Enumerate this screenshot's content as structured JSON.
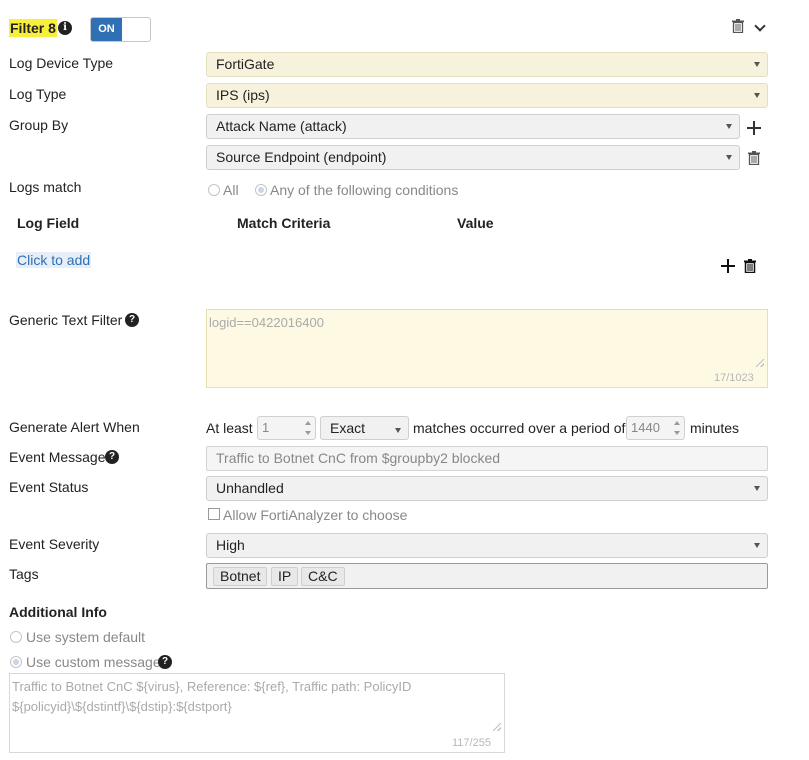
{
  "header": {
    "title": "Filter 8",
    "toggle_label": "ON",
    "delete_icon": "trash-icon",
    "collapse_icon": "chevron-down-icon"
  },
  "fields": {
    "log_device_type": {
      "label": "Log Device Type",
      "value": "FortiGate"
    },
    "log_type": {
      "label": "Log Type",
      "value": "IPS (ips)"
    },
    "group_by": {
      "label": "Group By",
      "values": [
        "Attack Name (attack)",
        "Source Endpoint (endpoint)"
      ]
    },
    "logs_match": {
      "label": "Logs match",
      "options": [
        "All",
        "Any of the following conditions"
      ],
      "selected": "Any of the following conditions"
    },
    "conditions_table": {
      "headers": [
        "Log Field",
        "Match Criteria",
        "Value"
      ],
      "add_link": "Click to add"
    },
    "generic_text_filter": {
      "label": "Generic Text Filter",
      "placeholder": "logid==0422016400",
      "counter": "17/1023"
    },
    "generate_alert": {
      "label": "Generate Alert When",
      "prefix": "At least",
      "count": "1",
      "mode": "Exact",
      "middle": "matches occurred over a period of",
      "period": "1440",
      "suffix": "minutes"
    },
    "event_message": {
      "label": "Event Message",
      "value": "Traffic to Botnet CnC from $groupby2 blocked"
    },
    "event_status": {
      "label": "Event Status",
      "value": "Unhandled",
      "checkbox_label": "Allow FortiAnalyzer to choose"
    },
    "event_severity": {
      "label": "Event Severity",
      "value": "High"
    },
    "tags": {
      "label": "Tags",
      "items": [
        "Botnet",
        "IP",
        "C&C"
      ]
    },
    "additional_info": {
      "label": "Additional Info",
      "options": [
        "Use system default",
        "Use custom message"
      ],
      "selected": "Use custom message",
      "message_line1": "Traffic to Botnet CnC ${virus},  Reference: ${ref}, Traffic path: PolicyID",
      "message_line2": "${policyid}\\${dstintf}\\${dstip}:${dstport}",
      "counter": "117/255"
    }
  },
  "colors": {
    "accent": "#2f6fb3",
    "highlight": "#f7ef3b",
    "selected_field": "#f6f2dc"
  }
}
